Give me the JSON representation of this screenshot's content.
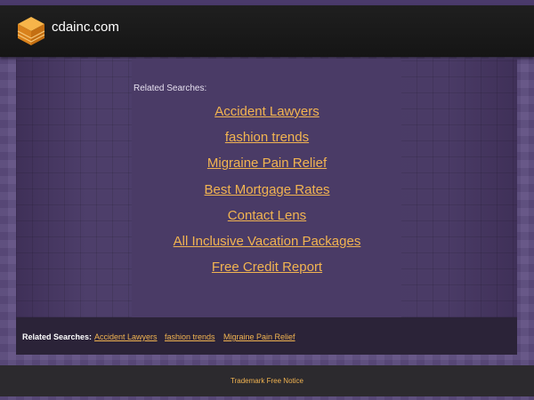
{
  "header": {
    "site_name": "cdainc.com",
    "logo_icon": "stacked-layers-logo-icon"
  },
  "main": {
    "related_label": "Related Searches:",
    "links": [
      "Accident Lawyers",
      "fashion trends",
      "Migraine Pain Relief",
      "Best Mortgage Rates",
      "Contact Lens",
      "All Inclusive Vacation Packages",
      "Free Credit Report"
    ]
  },
  "footer": {
    "label": "Related Searches:",
    "links": [
      "Accident Lawyers",
      "fashion trends",
      "Migraine Pain Relief"
    ]
  },
  "bottom": {
    "trademark": "Trademark Free Notice"
  },
  "colors": {
    "background": "#5e4d80",
    "header": "#1a1a1a",
    "link": "#f2b451",
    "logo_orange": "#f0a22e"
  }
}
